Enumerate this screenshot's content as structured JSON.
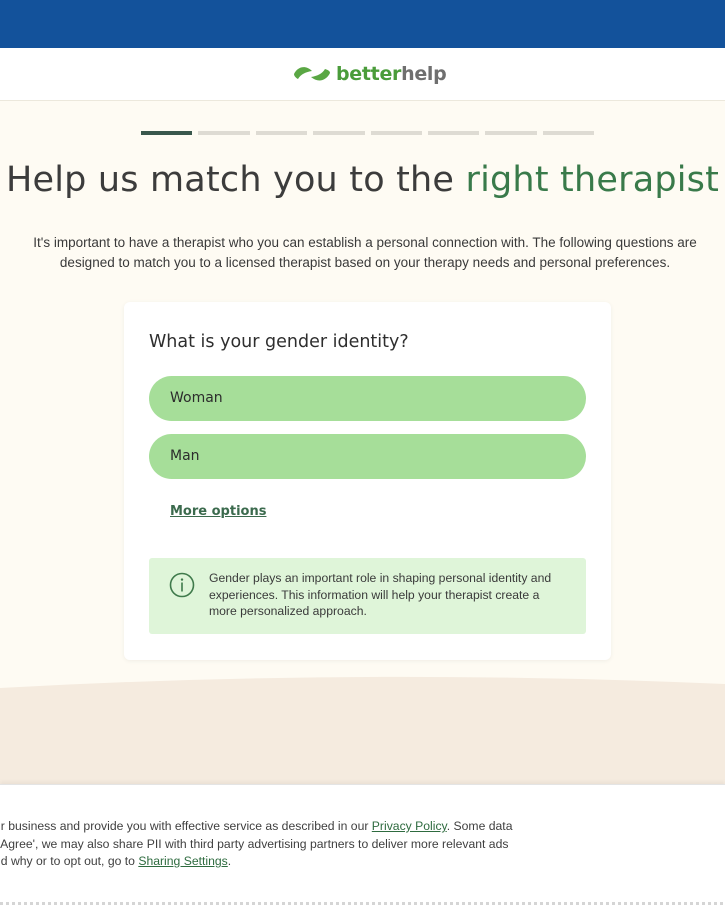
{
  "brand": {
    "name_part1": "better",
    "name_part2": "help",
    "logo_icon": "leaf-icon",
    "colors": {
      "topbar": "#13529b",
      "brand_green": "#4a9c3a",
      "accent_green": "#397a4a",
      "option_bg": "#a6de99"
    }
  },
  "progress": {
    "total_steps": 8,
    "current_step": 1
  },
  "headline": {
    "main": "Help us match you to the ",
    "accent": "right therapist"
  },
  "intro": "It's important to have a therapist who you can establish a personal connection with. The following questions are designed to match you to a licensed therapist based on your therapy needs and personal preferences.",
  "card": {
    "question": "What is your gender identity?",
    "options": [
      {
        "label": "Woman"
      },
      {
        "label": "Man"
      }
    ],
    "more_options": "More options",
    "info": {
      "icon": "info-icon",
      "text": "Gender plays an important role in shaping personal identity and experiences. This information will help your therapist create a more personalized approach."
    }
  },
  "cookie_banner": {
    "line1_pre": "ur business and provide you with effective service as described in our ",
    "line1_link": "Privacy Policy",
    "line1_post": ". Some data",
    "line2": "I Agree', we may also share PII with third party advertising partners to deliver more relevant ads",
    "line3_pre": "nd why or to opt out, go to ",
    "line3_link": "Sharing Settings",
    "line3_post": "."
  }
}
